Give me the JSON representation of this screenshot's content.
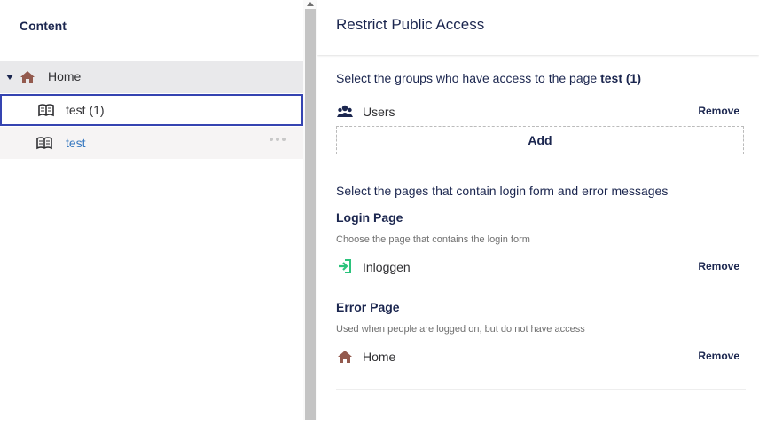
{
  "tree": {
    "title": "Content",
    "nodes": [
      {
        "label": "Home",
        "icon": "home-icon",
        "expanded": true
      },
      {
        "label": "test (1)",
        "icon": "book-icon",
        "selected": true
      },
      {
        "label": "test",
        "icon": "book-icon"
      }
    ]
  },
  "dialog": {
    "title": "Restrict Public Access",
    "groups": {
      "intro": "Select the groups who have access to the page",
      "page_name": "test (1)",
      "items": [
        {
          "label": "Users",
          "icon": "users-icon",
          "remove_label": "Remove"
        }
      ],
      "add_label": "Add"
    },
    "pages": {
      "intro": "Select the pages that contain login form and error messages",
      "login": {
        "heading": "Login Page",
        "hint": "Choose the page that contains the login form",
        "item": {
          "label": "Inloggen",
          "icon": "sign-in-icon",
          "remove_label": "Remove"
        }
      },
      "error": {
        "heading": "Error Page",
        "hint": "Used when people are logged on, but do not have access",
        "item": {
          "label": "Home",
          "icon": "home-icon",
          "remove_label": "Remove"
        }
      }
    }
  },
  "colors": {
    "text": "#1b264f",
    "link": "#3879c0",
    "home_icon": "#935a4e",
    "sign_in_icon": "#2bc37c",
    "selected_border": "#3544b1"
  }
}
